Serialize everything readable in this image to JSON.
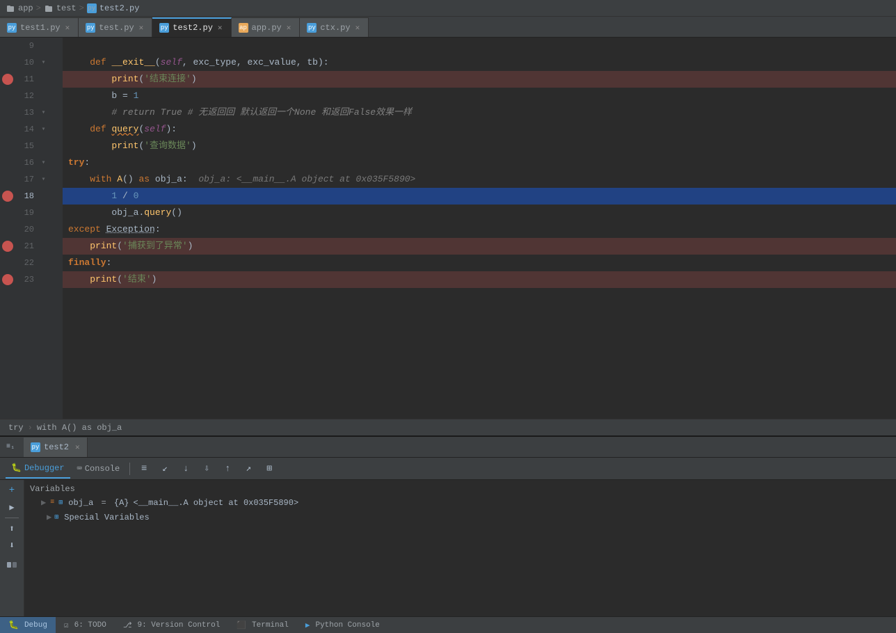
{
  "breadcrumb": {
    "parts": [
      "app",
      "test",
      "test2.py"
    ],
    "separators": [
      ">",
      ">"
    ]
  },
  "tabs": [
    {
      "id": "test1",
      "label": "test1.py",
      "type": "py",
      "active": false
    },
    {
      "id": "test",
      "label": "test.py",
      "type": "py",
      "active": false
    },
    {
      "id": "test2",
      "label": "test2.py",
      "type": "py",
      "active": true
    },
    {
      "id": "app",
      "label": "app.py",
      "type": "app",
      "active": false
    },
    {
      "id": "ctx",
      "label": "ctx.py",
      "type": "py",
      "active": false
    }
  ],
  "code_lines": [
    {
      "num": 9,
      "indent": 0,
      "text": "",
      "has_bp": false,
      "has_fold": false,
      "current": false
    },
    {
      "num": 10,
      "indent": 1,
      "text": "def __exit__(self, exc_type, exc_value, tb):",
      "has_bp": false,
      "has_fold": true,
      "current": false
    },
    {
      "num": 11,
      "indent": 2,
      "text": "print('结束连接')",
      "has_bp": true,
      "has_fold": false,
      "current": false
    },
    {
      "num": 12,
      "indent": 2,
      "text": "b = 1",
      "has_bp": false,
      "has_fold": false,
      "current": false
    },
    {
      "num": 13,
      "indent": 2,
      "text": "# return True # 无返回回 默认返回一个None 和返回False效果一样",
      "has_bp": false,
      "has_fold": true,
      "current": false
    },
    {
      "num": 14,
      "indent": 1,
      "text": "def query(self):",
      "has_bp": false,
      "has_fold": true,
      "current": false
    },
    {
      "num": 15,
      "indent": 2,
      "text": "print('查询数据')",
      "has_bp": false,
      "has_fold": false,
      "current": false
    },
    {
      "num": 16,
      "indent": 0,
      "text": "try:",
      "has_bp": false,
      "has_fold": true,
      "current": false
    },
    {
      "num": 17,
      "indent": 1,
      "text": "with A() as obj_a:",
      "has_bp": false,
      "has_fold": true,
      "current": false,
      "hint": "obj_a: <__main__.A object at 0x035F5890>"
    },
    {
      "num": 18,
      "indent": 2,
      "text": "1 / 0",
      "has_bp": true,
      "has_fold": false,
      "current": true
    },
    {
      "num": 19,
      "indent": 2,
      "text": "obj_a.query()",
      "has_bp": false,
      "has_fold": false,
      "current": false
    },
    {
      "num": 20,
      "indent": 0,
      "text": "except Exception:",
      "has_bp": false,
      "has_fold": false,
      "current": false
    },
    {
      "num": 21,
      "indent": 1,
      "text": "print('捕获到了异常')",
      "has_bp": true,
      "has_fold": false,
      "current": false
    },
    {
      "num": 22,
      "indent": 0,
      "text": "finally:",
      "has_bp": false,
      "has_fold": false,
      "current": false
    },
    {
      "num": 23,
      "indent": 1,
      "text": "print('结束')",
      "has_bp": true,
      "has_fold": false,
      "current": false
    }
  ],
  "editor_breadcrumb": {
    "parts": [
      "try",
      "with A() as obj_a"
    ]
  },
  "debug_panel": {
    "session_tab_label": "test2",
    "toolbar_items": [
      "Debugger",
      "Console"
    ],
    "active_toolbar": "Debugger",
    "variables_label": "Variables",
    "var_rows": [
      {
        "expand": true,
        "has_icon": true,
        "name": "obj_a",
        "eq": "=",
        "type": "{A}",
        "value": "<__main__.A object at 0x035F5890>"
      },
      {
        "expand": true,
        "has_icon": true,
        "name": "Special Variables",
        "eq": "",
        "type": "",
        "value": ""
      }
    ],
    "tool_btns": [
      "≡",
      "↑",
      "↓",
      "⬇",
      "⬆",
      "↑",
      "⇥",
      "⊞"
    ]
  },
  "status_bar": {
    "debug_label": "Debug",
    "todo_label": "6: TODO",
    "version_label": "9: Version Control",
    "terminal_label": "Terminal",
    "python_console_label": "Python Console"
  },
  "colors": {
    "accent": "#4a9eda",
    "breakpoint": "#c75450",
    "current_line": "#214283",
    "bp_bg": "rgba(193,84,80,0.25)"
  }
}
